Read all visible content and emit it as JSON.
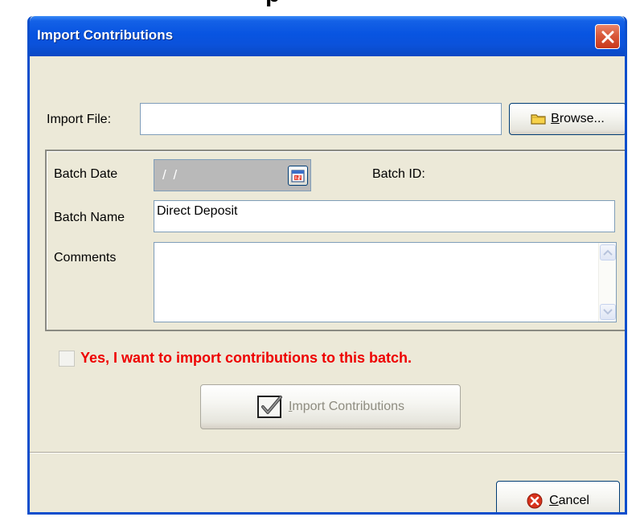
{
  "window": {
    "title": "Import Contributions",
    "top_fragment": "p"
  },
  "import_file": {
    "label": "Import File:",
    "value": "",
    "browse_label": "Browse..."
  },
  "batch": {
    "date_label": "Batch Date",
    "date_value": "/ /",
    "id_label": "Batch ID:",
    "id_value": "",
    "name_label": "Batch Name",
    "name_value": "Direct Deposit",
    "comments_label": "Comments",
    "comments_value": ""
  },
  "confirm": {
    "checked": false,
    "label": "Yes, I want to import contributions to this batch."
  },
  "actions": {
    "import_label": "Import Contributions",
    "import_enabled": false,
    "cancel_label": "Cancel"
  },
  "colors": {
    "titlebar": "#0854e1",
    "dialog_bg": "#ece9d8",
    "warning_text": "#ee0000",
    "close_button": "#d9593b"
  },
  "icons": {
    "close": "close-icon",
    "browse": "folder-icon",
    "calendar": "calendar-icon",
    "import": "checkmark-icon",
    "cancel": "cancel-icon",
    "scroll_up": "chevron-up-icon",
    "scroll_down": "chevron-down-icon"
  }
}
